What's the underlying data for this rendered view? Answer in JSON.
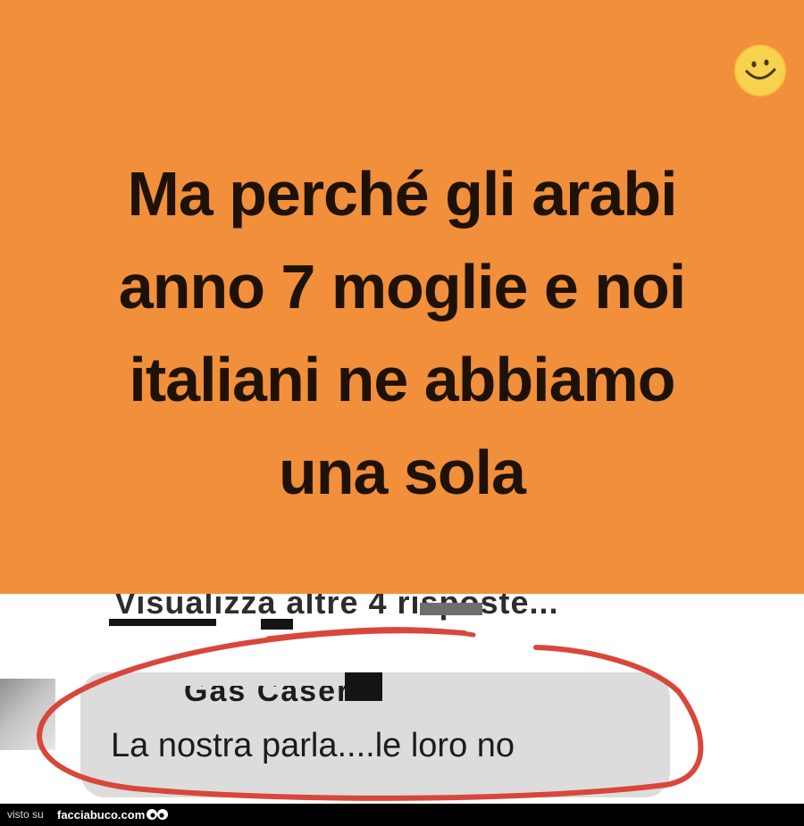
{
  "post": {
    "text": "Ma perché gli arabi\nanno 7 moglie e noi\nitaliani ne abbiamo\nuna sola",
    "emoji": "smiley-face-icon",
    "background_color": "#f28f3b"
  },
  "comments": {
    "view_more_replies": "Visualizza altre 4 risposte...",
    "reply": {
      "author": "Gas Casern",
      "text": "La nostra parla....le loro no"
    }
  },
  "annotation": {
    "type": "red-circle",
    "color": "#d9463a"
  },
  "watermark": {
    "prefix": "visto su",
    "site": "facciabuco.com",
    "icon": "eyes-icon"
  }
}
